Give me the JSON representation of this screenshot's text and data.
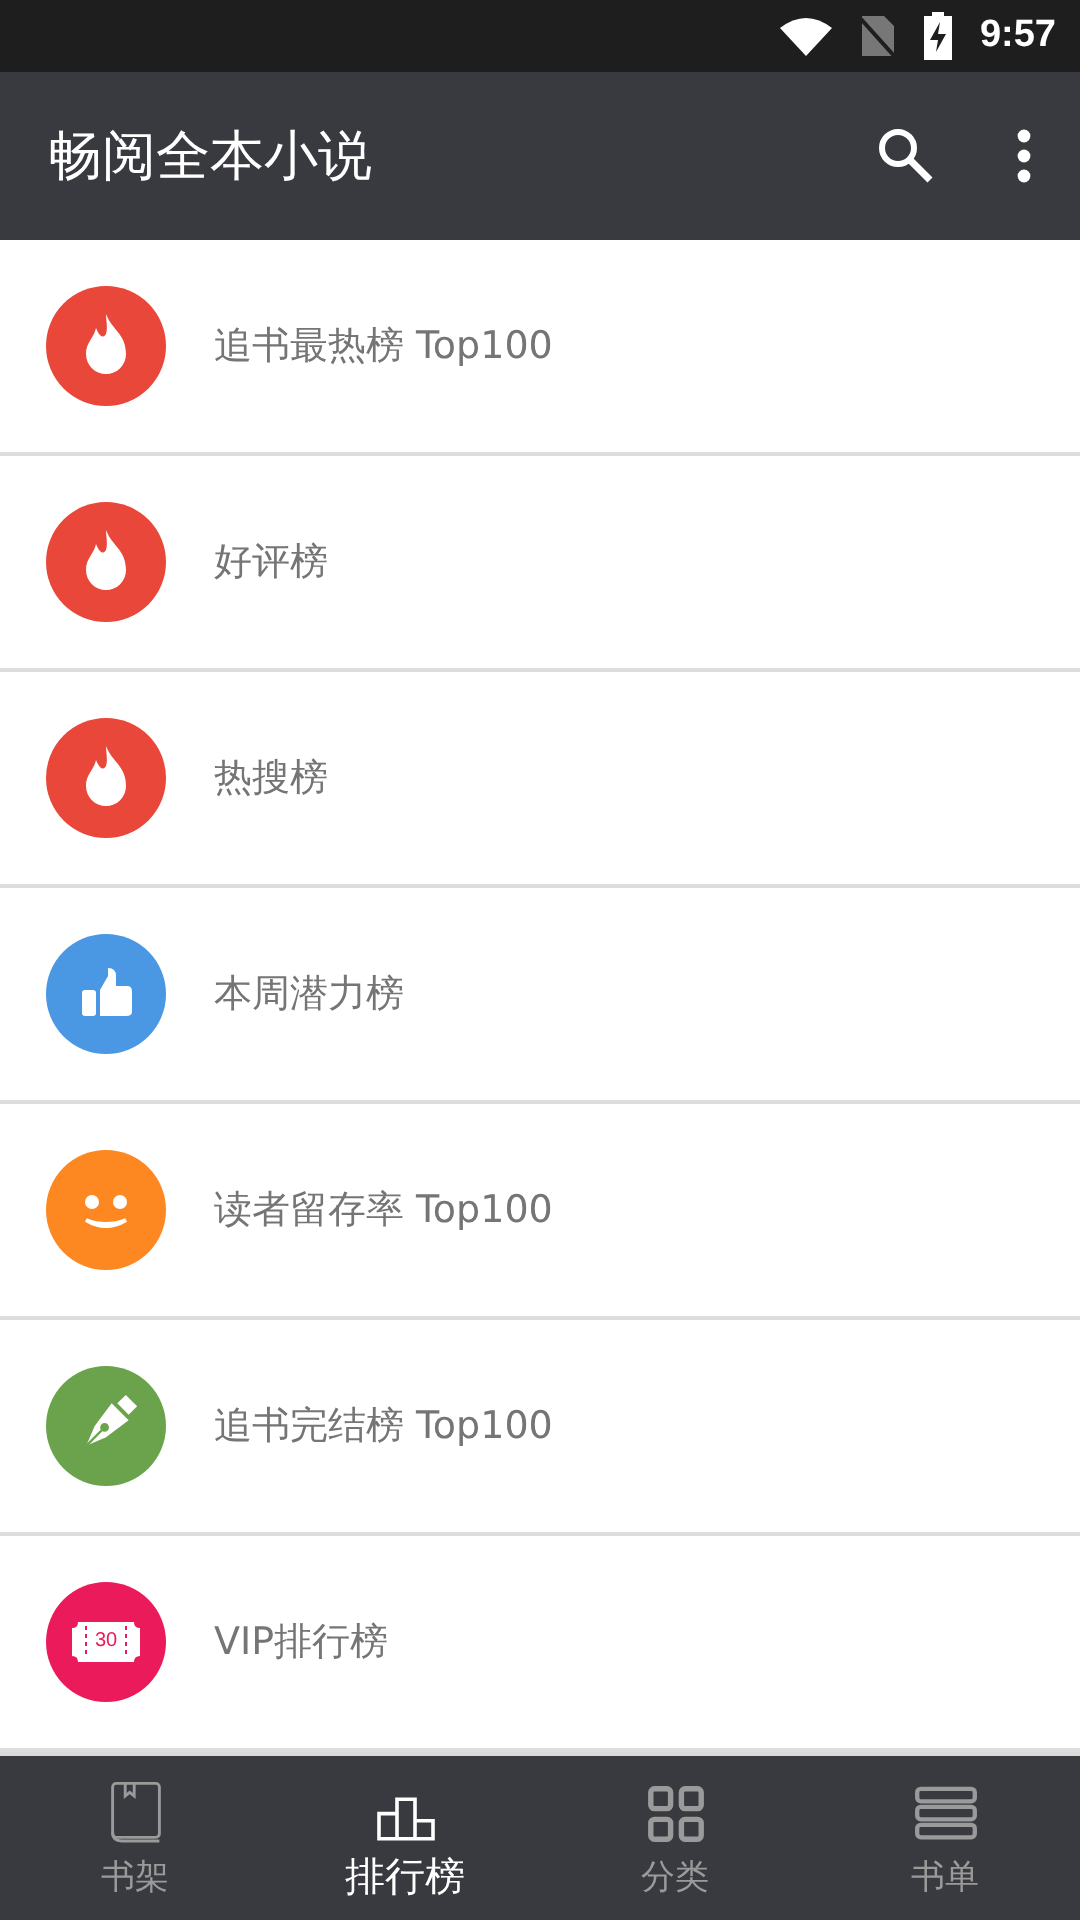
{
  "status_bar": {
    "time": "9:57"
  },
  "app_bar": {
    "title": "畅阅全本小说"
  },
  "list": [
    {
      "label": "追书最热榜 Top100",
      "kind": "flame",
      "color": "#e8473a"
    },
    {
      "label": "好评榜",
      "kind": "flame",
      "color": "#e8473a"
    },
    {
      "label": "热搜榜",
      "kind": "flame",
      "color": "#e8473a"
    },
    {
      "label": "本周潜力榜",
      "kind": "thumb",
      "color": "#4a97e3"
    },
    {
      "label": "读者留存率 Top100",
      "kind": "smile",
      "color": "#fd8721"
    },
    {
      "label": "追书完结榜 Top100",
      "kind": "pen",
      "color": "#6aa34c"
    },
    {
      "label": "VIP排行榜",
      "kind": "ticket",
      "color": "#ea1a5b",
      "icon_text": "30"
    }
  ],
  "bottom_nav": [
    {
      "label": "书架",
      "kind": "book",
      "selected": false
    },
    {
      "label": "排行榜",
      "kind": "podium",
      "selected": true
    },
    {
      "label": "分类",
      "kind": "grid",
      "selected": false
    },
    {
      "label": "书单",
      "kind": "stack",
      "selected": false
    }
  ]
}
